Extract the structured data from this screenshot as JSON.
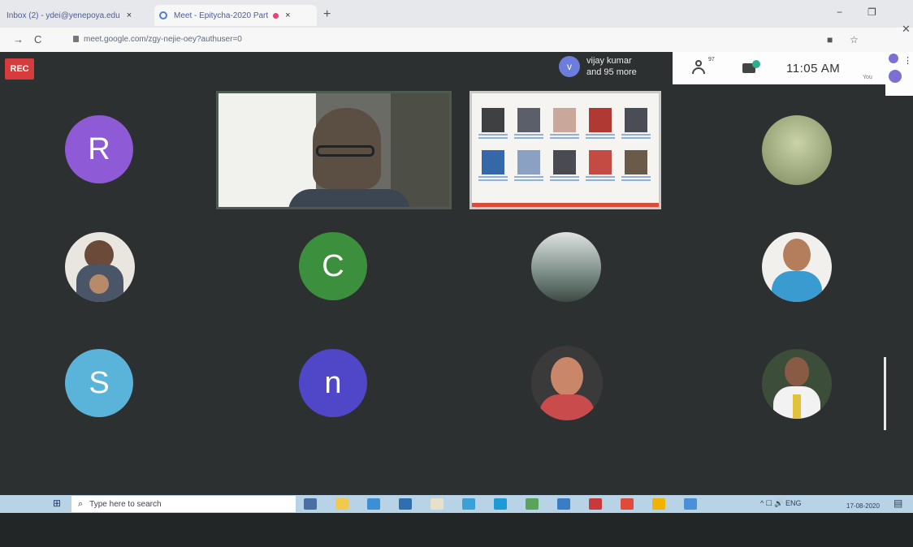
{
  "browser": {
    "tabs": [
      {
        "label": "Inbox (2) - ydei@yenepoya.edu",
        "close": "×"
      },
      {
        "label": "Meet - Epitycha-2020 Part",
        "close": "×"
      }
    ],
    "new_tab": "+",
    "minimize": "−",
    "restore": "❐",
    "back": "→",
    "reload": "C",
    "url": "meet.google.com/zgy-nejie-oey?authuser=0",
    "window_close": "✕"
  },
  "meet": {
    "rec_label": "REC",
    "presenter": {
      "initial": "v",
      "name": "vijay kumar",
      "more": "and 95 more"
    },
    "people_count": "97",
    "clock": "11:05 AM",
    "you_label": "You",
    "participants": [
      {
        "initial": "R",
        "color": "#8e5ad6"
      },
      {
        "initial": "C",
        "color": "#3c8f3c"
      },
      {
        "initial": "S",
        "color": "#5ab3d8"
      },
      {
        "initial": "n",
        "color": "#5046c8"
      }
    ]
  },
  "taskbar": {
    "start_glyph": "⊞",
    "search_glyph": "⌕",
    "search_placeholder": "Type here to search",
    "tray_text": "^  ☐  🔊  ENG",
    "date": "17-08-2020",
    "notif_glyph": "▤",
    "app_colors": [
      "#4a6fa5",
      "#f2c94c",
      "#3a8fd6",
      "#2f6fb0",
      "#e8e0c8",
      "#3aa0d8",
      "#1e9bd7",
      "#5aa35a",
      "#3a7cc5",
      "#c83a3a",
      "#e04a3a",
      "#f0b400",
      "#4a90d9"
    ]
  }
}
